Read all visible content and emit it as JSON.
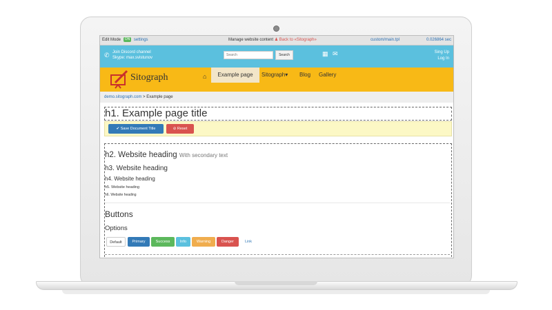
{
  "topbar": {
    "edit_mode": "Edit Mode",
    "on_tag": "ON",
    "settings": "settings",
    "manage": "Manage website content",
    "back": "Back to «Sitograph»",
    "tpl": "custom/main.tpl",
    "time": "0.026864 sec"
  },
  "infobar": {
    "discord_line1": "Join Discord channel",
    "discord_line2": "Skype: max.svistunov",
    "search_placeholder": "Search",
    "search_button": "Search",
    "sign_up": "Sing Up",
    "log_in": "Log In"
  },
  "navbar": {
    "logo": "Sitograph",
    "items": [
      "Example page",
      "Sitograph",
      "Blog",
      "Gallery"
    ]
  },
  "breadcrumb": {
    "link": "demo.sitograph.com",
    "sep": ">",
    "current": "Example page"
  },
  "content": {
    "h1": "h1. Example page title",
    "save_button": "Save Document Title",
    "reset_button": "Reset",
    "h2": "h2. Website heading",
    "h2_small": "With secondary text",
    "h3": "h3. Website heading",
    "h4": "h4. Website heading",
    "h5": "h5. Website heading",
    "h6": "h6. Website heading",
    "buttons_heading": "Buttons",
    "options_heading": "Options",
    "buttons": [
      "Default",
      "Primary",
      "Success",
      "Info",
      "Warning",
      "Danger",
      "Link"
    ]
  },
  "colors": {
    "infobar": "#5bc0de",
    "navbar": "#f8b916",
    "primary": "#337ab7",
    "success": "#5cb85c",
    "info": "#5bc0de",
    "warning": "#f0ad4e",
    "danger": "#d9534f"
  },
  "icons": [
    "phone-icon",
    "sitemap-icon",
    "mail-icon",
    "home-icon",
    "check-icon",
    "ban-icon",
    "logo-icon",
    "camera-icon"
  ]
}
